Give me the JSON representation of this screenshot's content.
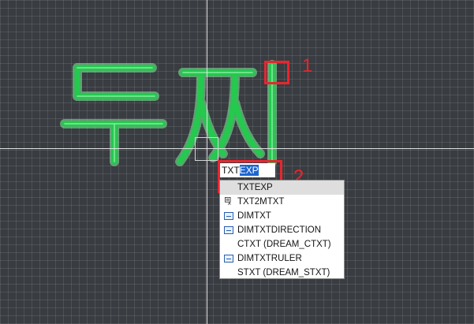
{
  "command_line": {
    "typed": "TXT",
    "completion_selected": "EXP"
  },
  "autocomplete": {
    "items": [
      {
        "label": "TXTEXP",
        "icon": "none",
        "highlighted": true
      },
      {
        "label": "TXT2MTXT",
        "icon": "text-convert-icon",
        "highlighted": false
      },
      {
        "label": "DIMTXT",
        "icon": "dimension-variable-icon",
        "highlighted": false
      },
      {
        "label": "DIMTXTDIRECTION",
        "icon": "dimension-variable-icon",
        "highlighted": false
      },
      {
        "label": "CTXT (DREAM_CTXT)",
        "icon": "none",
        "highlighted": false
      },
      {
        "label": "DIMTXTRULER",
        "icon": "dimension-variable-icon",
        "highlighted": false
      },
      {
        "label": "STXT (DREAM_STXT)",
        "icon": "none",
        "highlighted": false
      }
    ]
  },
  "annotations": [
    {
      "number": "1"
    },
    {
      "number": "2"
    }
  ],
  "colors": {
    "canvas_background": "#393c41",
    "grid_line": "#55585d",
    "crosshair": "#e9e9e9",
    "drawing_green": "#2fd35a",
    "drawing_glow": "#8ff0a8",
    "annotation_red": "#e8262e",
    "selection_blue": "#1e66d0"
  }
}
